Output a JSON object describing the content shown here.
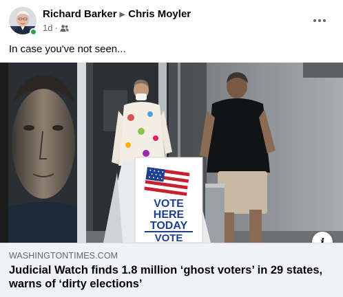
{
  "post": {
    "author": "Richard Barker",
    "group": "Chris Moyler",
    "timestamp": "1d",
    "dot": "·",
    "text": "In case you've not seen..."
  },
  "link": {
    "domain": "WASHINGTONTIMES.COM",
    "headline": "Judicial Watch finds 1.8 million ‘ghost voters’ in 29 states, warns of ‘dirty elections’"
  },
  "image": {
    "sign": {
      "line1": "VOTE",
      "line2": "HERE",
      "line3": "TODAY",
      "line4": "VOTE"
    }
  },
  "icons": {
    "audience": "friends-icon",
    "more": "more-options-icon",
    "info": "info-icon"
  },
  "colors": {
    "online": "#31a24c",
    "secondary_text": "#65676b",
    "preview_bg": "#f0f2f5",
    "sign_blue": "#1c3f94"
  }
}
